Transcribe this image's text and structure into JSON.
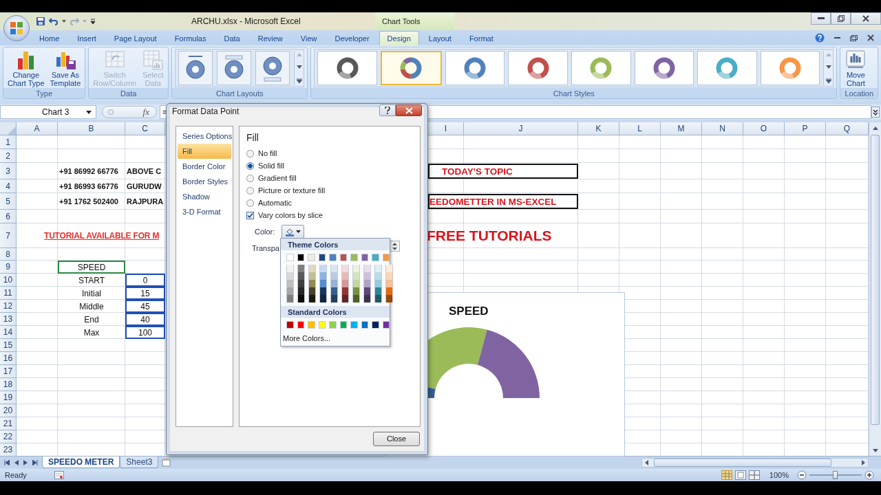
{
  "window": {
    "title": "ARCHU.xlsx - Microsoft Excel"
  },
  "tabs": [
    {
      "label": "Home",
      "selected": false
    },
    {
      "label": "Insert",
      "selected": false
    },
    {
      "label": "Page Layout",
      "selected": false
    },
    {
      "label": "Formulas",
      "selected": false
    },
    {
      "label": "Data",
      "selected": false
    },
    {
      "label": "Review",
      "selected": false
    },
    {
      "label": "View",
      "selected": false
    },
    {
      "label": "Developer",
      "selected": false
    }
  ],
  "chart_tools": {
    "title": "Chart Tools",
    "tabs": [
      {
        "label": "Design",
        "selected": true
      },
      {
        "label": "Layout",
        "selected": false
      },
      {
        "label": "Format",
        "selected": false
      }
    ]
  },
  "ribbon": {
    "groups": [
      {
        "label": "Type",
        "kind": "buttons",
        "buttons": [
          {
            "lines": [
              "Change",
              "Chart Type"
            ],
            "disabled": false,
            "kind": "chart"
          },
          {
            "lines": [
              "Save As",
              "Template"
            ],
            "disabled": false,
            "kind": "template"
          }
        ]
      },
      {
        "label": "Data",
        "kind": "buttons",
        "buttons": [
          {
            "lines": [
              "Switch",
              "Row/Column"
            ],
            "disabled": true,
            "kind": "switch"
          },
          {
            "lines": [
              "Select",
              "Data"
            ],
            "disabled": true,
            "kind": "table"
          }
        ]
      },
      {
        "label": "Chart Layouts",
        "kind": "layouts",
        "options": [
          {
            "kind": "title-top"
          },
          {
            "kind": "legend-top"
          },
          {
            "kind": "legend-bottom"
          }
        ]
      },
      {
        "label": "Chart Styles",
        "kind": "styles",
        "options": [
          {
            "kind": "mono",
            "color": "#595959",
            "selected": false
          },
          {
            "kind": "multi",
            "color": "#4f81bd",
            "selected": true
          },
          {
            "kind": "mono",
            "color": "#4f81bd",
            "selected": false
          },
          {
            "kind": "mono",
            "color": "#c0504d",
            "selected": false
          },
          {
            "kind": "mono",
            "color": "#9bbb59",
            "selected": false
          },
          {
            "kind": "mono",
            "color": "#8064a2",
            "selected": false
          },
          {
            "kind": "mono",
            "color": "#4bacc6",
            "selected": false
          },
          {
            "kind": "mono",
            "color": "#f79646",
            "selected": false
          }
        ]
      },
      {
        "label": "Location",
        "kind": "buttons",
        "buttons": [
          {
            "lines": [
              "Move",
              "Chart"
            ],
            "disabled": false,
            "kind": "move"
          }
        ]
      }
    ]
  },
  "formula_bar": {
    "name_box": "Chart 3",
    "fx_label": "fx",
    "formula": "="
  },
  "sheet": {
    "columns": [
      "A",
      "B",
      "C",
      "I",
      "J",
      "K",
      "L",
      "M",
      "N",
      "O",
      "P",
      "Q"
    ],
    "rows": [
      {
        "n": "1",
        "cells": []
      },
      {
        "n": "2",
        "cells": []
      },
      {
        "n": "3",
        "cells": [
          "",
          {
            "kind": "bold",
            "text": "+91 86992 66776"
          },
          {
            "kind": "bold",
            "text": "ABOVE C"
          },
          {
            "kind": "topic",
            "text": "TODAY'S TOPIC"
          }
        ]
      },
      {
        "n": "4",
        "cells": [
          "",
          {
            "kind": "bold",
            "text": "+91 86993 66776"
          },
          {
            "kind": "bold",
            "text": "GURUDW"
          }
        ]
      },
      {
        "n": "5",
        "cells": [
          "",
          {
            "kind": "bold",
            "text": "+91 1762 502400"
          },
          {
            "kind": "bold",
            "text": "RAJPURA"
          },
          {
            "kind": "topic-cut",
            "text": "EEDOMETTER IN MS-EXCEL"
          }
        ]
      },
      {
        "n": "6",
        "cells": []
      },
      {
        "n": "7",
        "cells": [
          "",
          {
            "kind": "heading",
            "text": "TUTORIAL AVAILABLE FOR M"
          },
          "",
          {
            "kind": "banner",
            "text": "FREE TUTORIALS"
          }
        ]
      },
      {
        "n": "8",
        "cells": []
      },
      {
        "n": "9",
        "cells": [
          "",
          {
            "kind": "label",
            "color": "#2a8a3e",
            "text": "SPEED"
          }
        ]
      },
      {
        "n": "10",
        "cells": [
          "",
          {
            "kind": "label",
            "text": "START"
          },
          {
            "kind": "label",
            "color": "#2050b8",
            "text": "0"
          }
        ]
      },
      {
        "n": "11",
        "cells": [
          "",
          {
            "kind": "label",
            "text": "Initial"
          },
          {
            "kind": "label",
            "color": "#2050b8",
            "text": "15"
          }
        ]
      },
      {
        "n": "12",
        "cells": [
          "",
          {
            "kind": "label",
            "text": "Middle"
          },
          {
            "kind": "label",
            "color": "#2050b8",
            "text": "45"
          }
        ]
      },
      {
        "n": "13",
        "cells": [
          "",
          {
            "kind": "label",
            "text": "End"
          },
          {
            "kind": "label",
            "color": "#2050b8",
            "text": "40"
          }
        ]
      },
      {
        "n": "14",
        "cells": [
          "",
          {
            "kind": "label",
            "text": "Max"
          },
          {
            "kind": "label",
            "color": "#2050b8",
            "text": "100"
          }
        ]
      },
      {
        "n": "15",
        "cells": []
      },
      {
        "n": "16",
        "cells": []
      },
      {
        "n": "17",
        "cells": []
      },
      {
        "n": "18",
        "cells": []
      },
      {
        "n": "19",
        "cells": []
      },
      {
        "n": "20",
        "cells": []
      },
      {
        "n": "21",
        "cells": []
      },
      {
        "n": "22",
        "cells": []
      },
      {
        "n": "23",
        "cells": []
      }
    ]
  },
  "chart": {
    "title": "SPEED"
  },
  "dialog": {
    "title": "Format Data Point",
    "nav": [
      {
        "label": "Series Options",
        "selected": false
      },
      {
        "label": "Fill",
        "selected": true
      },
      {
        "label": "Border Color",
        "selected": false
      },
      {
        "label": "Border Styles",
        "selected": false
      },
      {
        "label": "Shadow",
        "selected": false
      },
      {
        "label": "3-D Format",
        "selected": false
      }
    ],
    "section": "Fill",
    "fill_options": [
      {
        "label": "No fill",
        "selected": false
      },
      {
        "label": "Solid fill",
        "selected": true
      },
      {
        "label": "Gradient fill",
        "selected": false
      },
      {
        "label": "Picture or texture fill",
        "selected": false
      },
      {
        "label": "Automatic",
        "selected": false
      }
    ],
    "vary_colors": {
      "label": "Vary colors by slice",
      "checked": true
    },
    "color_label": "Color:",
    "transparency_label": "Transpa",
    "close": "Close"
  },
  "palette": {
    "theme_title": "Theme Colors",
    "theme": [
      {
        "color": "#ffffff",
        "shades": [
          {
            "color": "#f2f2f2"
          },
          {
            "color": "#d8d8d8"
          },
          {
            "color": "#bfbfbf"
          },
          {
            "color": "#a5a5a5"
          },
          {
            "color": "#7f7f7f"
          }
        ]
      },
      {
        "color": "#000000",
        "shades": [
          {
            "color": "#7f7f7f"
          },
          {
            "color": "#595959"
          },
          {
            "color": "#3f3f3f"
          },
          {
            "color": "#262626"
          },
          {
            "color": "#0c0c0c"
          }
        ]
      },
      {
        "color": "#eeece1",
        "shades": [
          {
            "color": "#ddd9c3"
          },
          {
            "color": "#c4bd97"
          },
          {
            "color": "#938953"
          },
          {
            "color": "#494429"
          },
          {
            "color": "#1d1b10"
          }
        ]
      },
      {
        "color": "#1f497d",
        "shades": [
          {
            "color": "#c6d9f0"
          },
          {
            "color": "#8db3e2"
          },
          {
            "color": "#548dd4"
          },
          {
            "color": "#17365d"
          },
          {
            "color": "#0f243e"
          }
        ]
      },
      {
        "color": "#4f81bd",
        "shades": [
          {
            "color": "#dbe5f1"
          },
          {
            "color": "#b8cce4"
          },
          {
            "color": "#95b3d7"
          },
          {
            "color": "#366092"
          },
          {
            "color": "#244061"
          }
        ]
      },
      {
        "color": "#c0504d",
        "shades": [
          {
            "color": "#f2dcdb"
          },
          {
            "color": "#e5b9b7"
          },
          {
            "color": "#d99694"
          },
          {
            "color": "#953734"
          },
          {
            "color": "#632423"
          }
        ]
      },
      {
        "color": "#9bbb59",
        "shades": [
          {
            "color": "#ebf1dd"
          },
          {
            "color": "#d7e3bc"
          },
          {
            "color": "#c3d69b"
          },
          {
            "color": "#76923c"
          },
          {
            "color": "#4f6128"
          }
        ]
      },
      {
        "color": "#8064a2",
        "shades": [
          {
            "color": "#e5e0ec"
          },
          {
            "color": "#ccc1d9"
          },
          {
            "color": "#b2a2c7"
          },
          {
            "color": "#5f497a"
          },
          {
            "color": "#3f3151"
          }
        ]
      },
      {
        "color": "#4bacc6",
        "shades": [
          {
            "color": "#dbeef3"
          },
          {
            "color": "#b7dde8"
          },
          {
            "color": "#92cddc"
          },
          {
            "color": "#31859b"
          },
          {
            "color": "#205867"
          }
        ]
      },
      {
        "color": "#f79646",
        "shades": [
          {
            "color": "#fdeada"
          },
          {
            "color": "#fbd5b5"
          },
          {
            "color": "#fac08f"
          },
          {
            "color": "#e36c09"
          },
          {
            "color": "#974806"
          }
        ]
      }
    ],
    "standard_title": "Standard Colors",
    "standard": [
      {
        "color": "#c00000"
      },
      {
        "color": "#ff0000"
      },
      {
        "color": "#ffc000"
      },
      {
        "color": "#ffff00"
      },
      {
        "color": "#92d050"
      },
      {
        "color": "#00b050"
      },
      {
        "color": "#00b0f0"
      },
      {
        "color": "#0070c0"
      },
      {
        "color": "#002060"
      },
      {
        "color": "#7030a0"
      }
    ],
    "more": "More Colors..."
  },
  "sheet_tabs": [
    {
      "label": "SPEEDO METER",
      "selected": true
    },
    {
      "label": "Sheet3",
      "selected": false
    }
  ],
  "status_bar": {
    "text": "Ready",
    "zoom": "100%",
    "zoom_slider": {
      "level": 0.5
    }
  }
}
